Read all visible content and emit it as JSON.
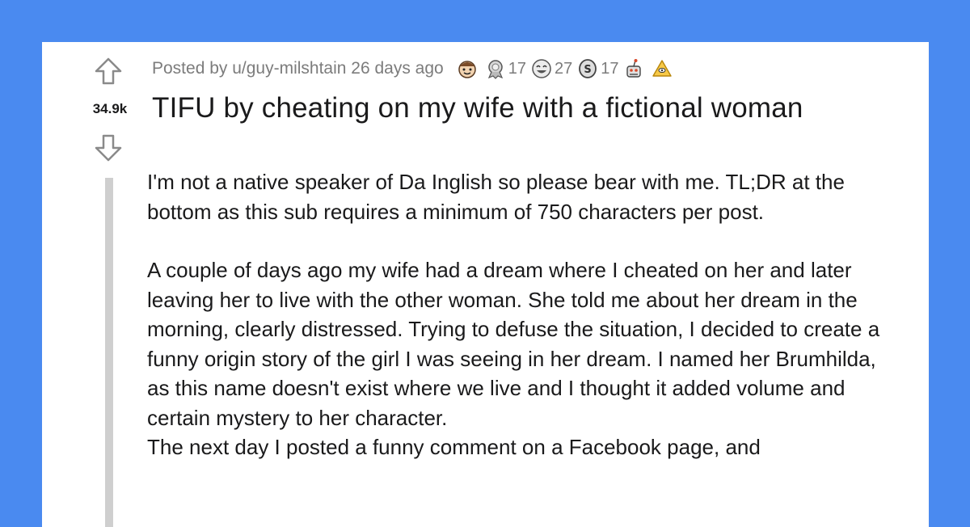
{
  "post": {
    "score": "34.9k",
    "posted_by": "Posted by u/guy-milshtain 26 days ago",
    "title": "TIFU by cheating on my wife with a fictional woman",
    "awards": [
      {
        "icon": "wholesome-face-icon",
        "count": ""
      },
      {
        "icon": "silver-award-icon",
        "count": "17"
      },
      {
        "icon": "laughing-face-icon",
        "count": "27"
      },
      {
        "icon": "coin-award-icon",
        "count": "17"
      },
      {
        "icon": "snoo-award-icon",
        "count": ""
      },
      {
        "icon": "gold-triangle-icon",
        "count": ""
      }
    ],
    "paragraphs": [
      "I'm not a native speaker of Da Inglish so please bear with me. TL;DR at the bottom as this sub requires a minimum of 750 characters per post.",
      "A couple of days ago my wife had a dream where I cheated on her and later leaving her to live with the other woman. She told me about her dream in the morning, clearly distressed. Trying to defuse the situation, I decided to create a funny origin story of the girl I was seeing in her dream. I named her Brumhilda, as this name doesn't exist where we live and I thought it added volume and certain mystery to her character.",
      "The next day I posted a funny comment on a Facebook page, and"
    ]
  },
  "colors": {
    "background": "#4a8af0",
    "card": "#ffffff",
    "meta_text": "#7c7c7c",
    "title_text": "#1a1a1b",
    "thread_line": "#cfcfcf"
  }
}
